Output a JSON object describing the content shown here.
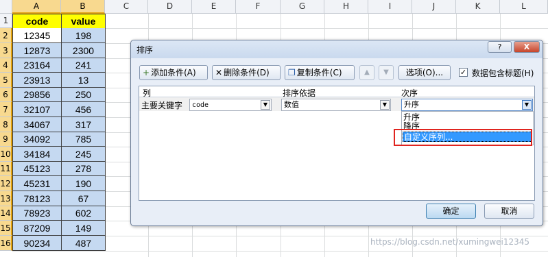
{
  "columns": [
    "A",
    "B",
    "C",
    "D",
    "E",
    "F",
    "G",
    "H",
    "I",
    "J",
    "K",
    "L"
  ],
  "rows": [
    "1",
    "2",
    "3",
    "4",
    "5",
    "6",
    "7",
    "8",
    "9",
    "10",
    "11",
    "12",
    "13",
    "14",
    "15",
    "16"
  ],
  "table": {
    "headers": [
      "code",
      "value"
    ],
    "data": [
      [
        "12345",
        "198"
      ],
      [
        "12873",
        "2300"
      ],
      [
        "23164",
        "241"
      ],
      [
        "23913",
        "13"
      ],
      [
        "29856",
        "250"
      ],
      [
        "32107",
        "456"
      ],
      [
        "34067",
        "317"
      ],
      [
        "34092",
        "785"
      ],
      [
        "34184",
        "245"
      ],
      [
        "45123",
        "278"
      ],
      [
        "45231",
        "190"
      ],
      [
        "78123",
        "67"
      ],
      [
        "78923",
        "602"
      ],
      [
        "87209",
        "149"
      ],
      [
        "90234",
        "487"
      ]
    ]
  },
  "dialog": {
    "title": "排序",
    "help_btn": "?",
    "close_btn": "X",
    "add_level": "添加条件(A)",
    "delete_level": "删除条件(D)",
    "copy_level": "复制条件(C)",
    "move_up": "▲",
    "move_down": "▼",
    "options": "选项(O)...",
    "has_headers_label": "数据包含标题(H)",
    "has_headers_checked": "✓",
    "col_header": "列",
    "sort_on_header": "排序依据",
    "order_header": "次序",
    "row_label": "主要关键字",
    "column_value": "code",
    "sort_on_value": "数值",
    "order_value": "升序",
    "order_options": [
      "升序",
      "降序",
      "自定义序列..."
    ],
    "ok": "确定",
    "cancel": "取消"
  },
  "watermark": "https://blog.csdn.net/xumingwei12345",
  "colors": {
    "header_fill": "#ffff00",
    "data_fill": "#c5d9f1",
    "highlight": "#3399ff",
    "red_box": "#e0241f"
  }
}
